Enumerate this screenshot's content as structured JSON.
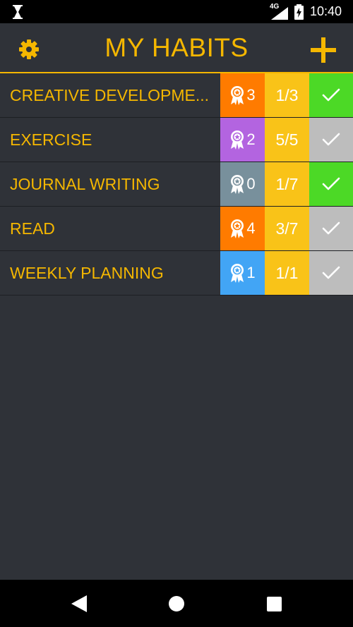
{
  "status_bar": {
    "network": "4G",
    "time": "10:40"
  },
  "header": {
    "title": "MY HABITS",
    "settings_icon": "gear-icon",
    "add_icon": "plus-icon",
    "accent_color": "#f5b700"
  },
  "habits": [
    {
      "name": "CREATIVE DEVELOPME...",
      "award_count": "3",
      "award_color": "#ff7b00",
      "progress": "1/3",
      "progress_color": "#f9c318",
      "check_color": "#4cd926",
      "completed": true
    },
    {
      "name": "EXERCISE",
      "award_count": "2",
      "award_color": "#b364e0",
      "progress": "5/5",
      "progress_color": "#f9c318",
      "check_color": "#bdbdbd",
      "completed": false
    },
    {
      "name": "JOURNAL WRITING",
      "award_count": "0",
      "award_color": "#78909c",
      "progress": "1/7",
      "progress_color": "#f9c318",
      "check_color": "#4cd926",
      "completed": true
    },
    {
      "name": "READ",
      "award_count": "4",
      "award_color": "#ff7b00",
      "progress": "3/7",
      "progress_color": "#f9c318",
      "check_color": "#bdbdbd",
      "completed": false
    },
    {
      "name": "WEEKLY PLANNING",
      "award_count": "1",
      "award_color": "#42a5f5",
      "progress": "1/1",
      "progress_color": "#f9c318",
      "check_color": "#bdbdbd",
      "completed": false
    }
  ],
  "nav_bar": {
    "back_icon": "back-triangle-icon",
    "home_icon": "home-circle-icon",
    "recents_icon": "recents-square-icon"
  }
}
